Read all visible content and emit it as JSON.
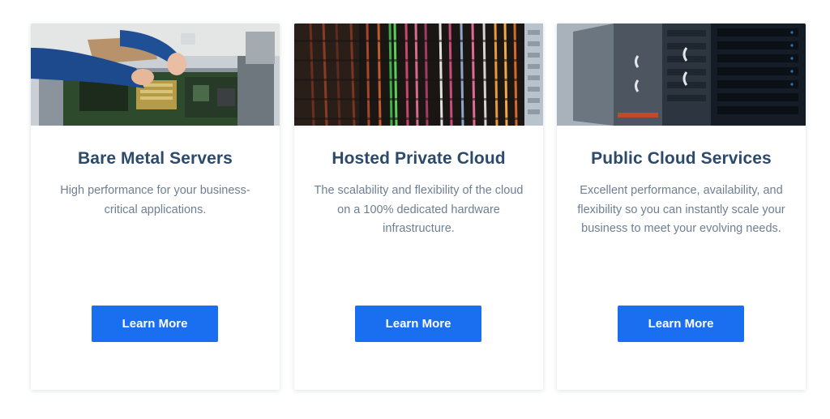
{
  "cards": [
    {
      "image_name": "bare-metal-hardware-photo",
      "title": "Bare Metal Servers",
      "description": "High performance for your business-critical applications.",
      "button_label": "Learn More"
    },
    {
      "image_name": "datacenter-cabling-photo",
      "title": "Hosted Private Cloud",
      "description": "The scalability and flexibility of the cloud on a 100% dedicated hardware infrastructure.",
      "button_label": "Learn More"
    },
    {
      "image_name": "server-rack-aisle-photo",
      "title": "Public Cloud Services",
      "description": "Excellent performance, availability, and flexibility so you can instantly scale your business to meet your evolving needs.",
      "button_label": "Learn More"
    }
  ],
  "colors": {
    "title": "#2d4a6b",
    "description": "#6e7f93",
    "button": "#1a6ef0",
    "button_text": "#ffffff"
  }
}
